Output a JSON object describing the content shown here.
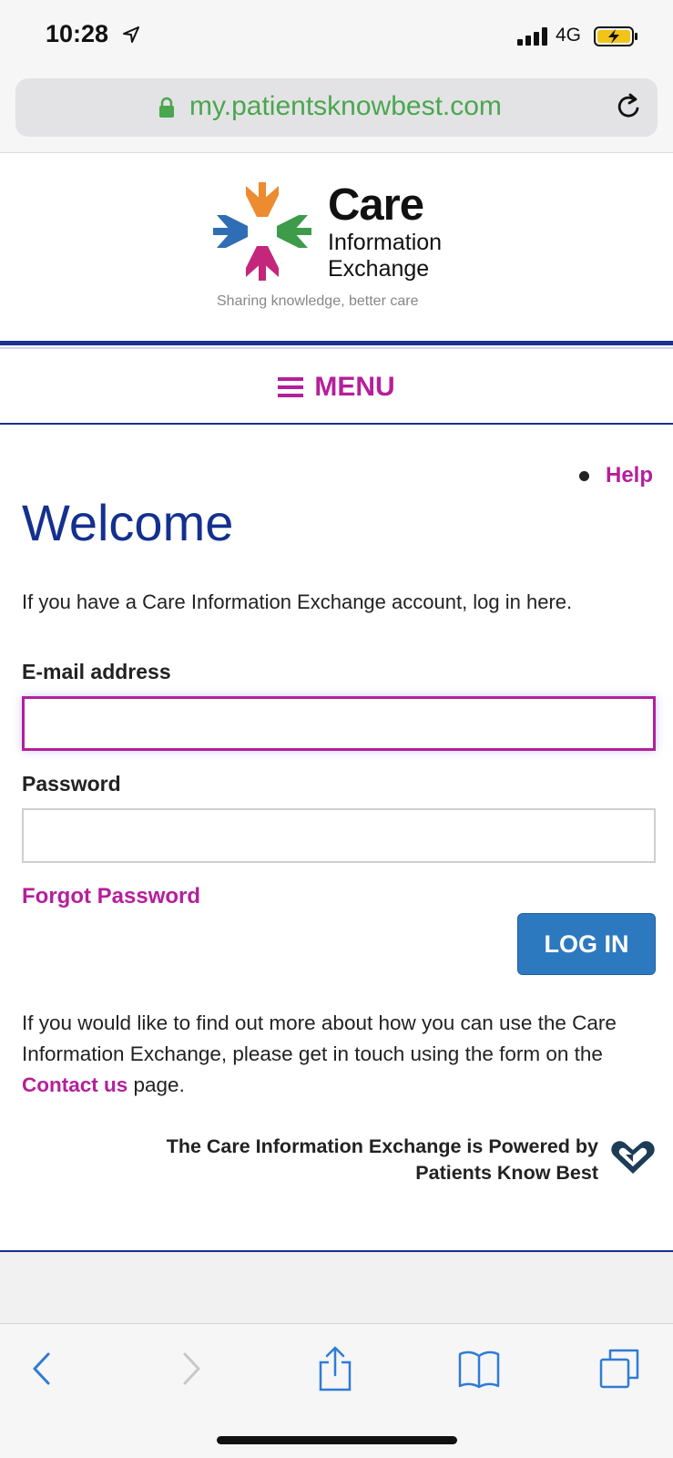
{
  "status_bar": {
    "time": "10:28",
    "network": "4G",
    "icons": [
      "location-arrow-icon",
      "signal-bars-icon",
      "battery-charging-icon"
    ]
  },
  "browser": {
    "url": "my.patientsknowbest.com",
    "icons": [
      "lock-icon",
      "reload-icon"
    ]
  },
  "header": {
    "logo_word1": "Care",
    "logo_word2": "Information",
    "logo_word3": "Exchange",
    "tagline": "Sharing knowledge, better care",
    "menu_label": "MENU",
    "colors": {
      "brand_blue": "#14308f",
      "accent_magenta": "#b51f9b",
      "button_blue": "#2d79c0"
    }
  },
  "main": {
    "help_link": "Help",
    "title": "Welcome",
    "intro": "If you have a Care Information Exchange account, log in here.",
    "email_label": "E-mail address",
    "email_value": "",
    "password_label": "Password",
    "password_value": "",
    "forgot_password": "Forgot Password",
    "login_button": "LOG IN",
    "info_before": "If you would like to find out more about how you can use the Care Information Exchange, please get in touch using the form on the ",
    "contact_link": "Contact us",
    "info_after": " page.",
    "powered_line1": "The Care Information Exchange is Powered by",
    "powered_line2": "Patients Know Best"
  },
  "toolbar": {
    "icons": [
      "back-icon",
      "forward-icon",
      "share-icon",
      "bookmarks-icon",
      "tabs-icon"
    ]
  }
}
